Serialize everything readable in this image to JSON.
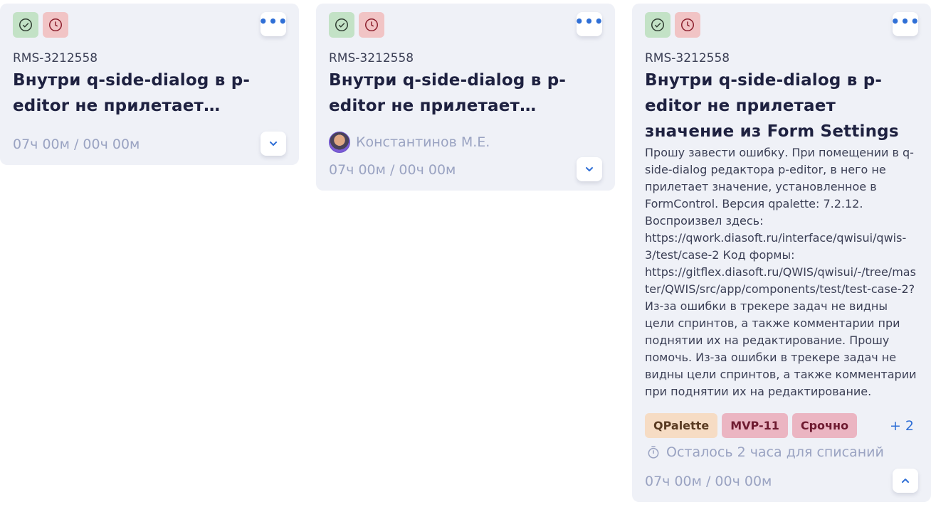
{
  "cards": [
    {
      "task_id": "RMS-3212558",
      "title": "Внутри q-side-dialog в p-editor не прилетает значение из For...",
      "time": "07ч 00м / 00ч 00м",
      "status_icons": [
        "check-circle-icon",
        "clock-icon"
      ],
      "expanded": false
    },
    {
      "task_id": "RMS-3212558",
      "title": "Внутри q-side-dialog в p-editor не прилетает значение из For...",
      "assignee": "Константинов М.Е.",
      "time": "07ч 00м / 00ч 00м",
      "status_icons": [
        "check-circle-icon",
        "clock-icon"
      ],
      "expanded": false
    },
    {
      "task_id": "RMS-3212558",
      "title": "Внутри q-side-dialog в p-editor не прилетает значение из Form Settings",
      "description": "Прошу завести ошибку.  При помещении в q-side-dialog редактора p-editor, в него не прилетает значение, установленное в FormControl.  Версия qpalette: 7.2.12.  Воспроизвел здесь:  https://qwork.diasoft.ru/interface/qwisui/qwis-3/test/case-2   Код формы:  https://gitflex.diasoft.ru/QWIS/qwisui/-/tree/master/QWIS/src/app/components/test/test-case-2?   Из-за ошибки в трекере задач не видны цели спринтов, а также комментарии при поднятии их на редактирование. Прошу помочь. Из-за ошибки в трекере задач не видны цели спринтов, а также комментарии при поднятии их на редактирование.",
      "tags": [
        "QPalette",
        "MVP-11",
        "Срочно"
      ],
      "more_tags": "+ 2",
      "deadline": "Осталось 2 часа для списаний",
      "time": "07ч 00м / 00ч 00м",
      "status_icons": [
        "check-circle-icon",
        "clock-icon"
      ],
      "expanded": true
    }
  ],
  "colors": {
    "card_bg": "#eff1f7",
    "done_icon_bg": "#c3e2c6",
    "late_icon_bg": "#f1c4c5",
    "accent": "#2f6fd6",
    "muted_text": "#9aa3c2",
    "title_text": "#1e2140"
  }
}
